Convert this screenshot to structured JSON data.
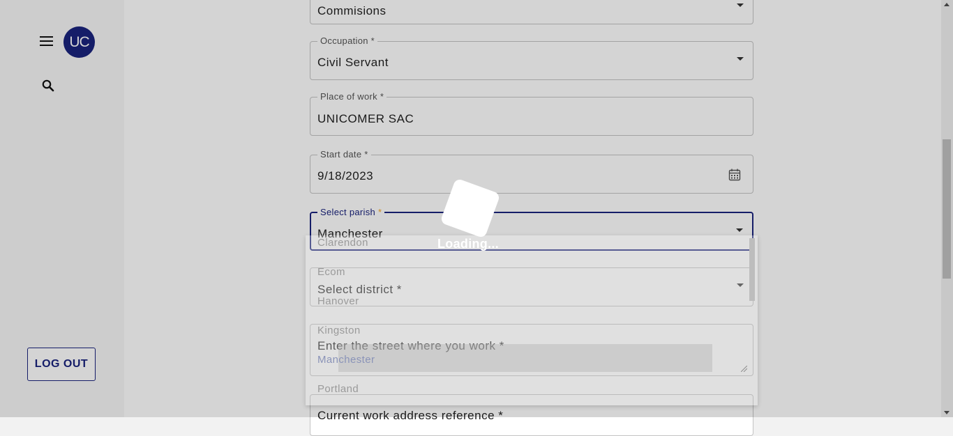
{
  "sidebar": {
    "avatar_initials": "UC",
    "logout_label": "LOG OUT"
  },
  "form": {
    "income_type": {
      "value": "Commisions"
    },
    "occupation": {
      "label": "Occupation *",
      "value": "Civil Servant"
    },
    "place_of_work": {
      "label": "Place of work *",
      "value": "UNICOMER SAC"
    },
    "start_date": {
      "label": "Start date *",
      "value": "9/18/2023"
    },
    "parish": {
      "label": "Select parish",
      "required_mark": "*",
      "value": "Manchester"
    },
    "district": {
      "value": "Select district *"
    },
    "street": {
      "value": "Enter the street where you work *"
    },
    "address_reference": {
      "value": "Current work address reference *"
    }
  },
  "parish_dropdown": {
    "options": [
      "Clarendon",
      "Ecom",
      "Hanover",
      "Kingston",
      "Manchester",
      "Portland"
    ]
  },
  "loading": {
    "text": "Loading..."
  },
  "colors": {
    "brand": "#1a237e",
    "required": "#f5a623"
  }
}
